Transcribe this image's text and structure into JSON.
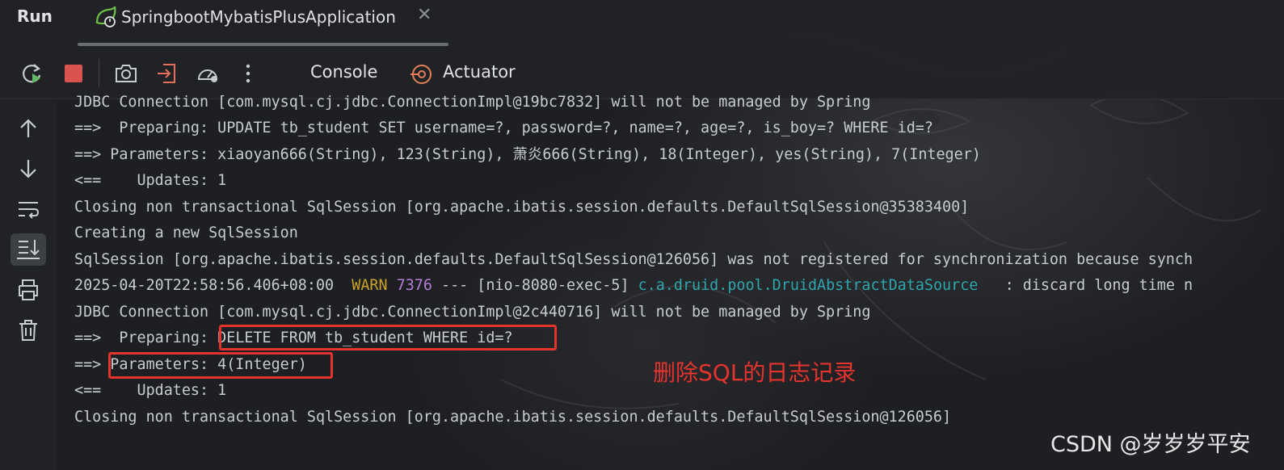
{
  "window": {
    "run_label": "Run",
    "tab_title": "SpringbootMybatisPlusApplication",
    "tab_close": "✕"
  },
  "toolbar": {
    "tabs": [
      "Console",
      "Actuator"
    ]
  },
  "console": {
    "lines": [
      {
        "text": "JDBC Connection [com.mysql.cj.jdbc.ConnectionImpl@19bc7832] will not be managed by Spring"
      },
      {
        "text": "==>  Preparing: UPDATE tb_student SET username=?, password=?, name=?, age=?, is_boy=? WHERE id=?"
      },
      {
        "text": "==> Parameters: xiaoyan666(String), 123(String), 萧炎666(String), 18(Integer), yes(String), 7(Integer)"
      },
      {
        "text": "<==    Updates: 1"
      },
      {
        "text": "Closing non transactional SqlSession [org.apache.ibatis.session.defaults.DefaultSqlSession@35383400]"
      },
      {
        "text": "Creating a new SqlSession"
      },
      {
        "text": "SqlSession [org.apache.ibatis.session.defaults.DefaultSqlSession@126056] was not registered for synchronization because synch"
      },
      {
        "timestamp": "2025-04-20T22:58:56.406+08:00",
        "level": "WARN",
        "pid": "7376",
        "thread": "--- [nio-8080-exec-5]",
        "logger": "c.a.druid.pool.DruidAbstractDataSource",
        "message": ": discard long time n"
      },
      {
        "text": "JDBC Connection [com.mysql.cj.jdbc.ConnectionImpl@2c440716] will not be managed by Spring"
      },
      {
        "prefix": "==>  Preparing:",
        "highlight": "DELETE FROM tb_student WHERE id=?"
      },
      {
        "prefix": "==>",
        "highlight": "Parameters: 4(Integer)"
      },
      {
        "text": "<==    Updates: 1"
      },
      {
        "text": "Closing non transactional SqlSession [org.apache.ibatis.session.defaults.DefaultSqlSession@126056]"
      }
    ]
  },
  "annotation": "删除SQL的日志记录",
  "watermark": "CSDN @岁岁岁平安",
  "colors": {
    "background": "#1e1f22",
    "text": "#c8cbd0",
    "warn": "#c9a227",
    "pid": "#b37fd6",
    "logger": "#2ea6ad",
    "highlight": "#e5332e",
    "stop": "#d9534f",
    "rerun": "#5fb865"
  },
  "icons": [
    "rerun-icon",
    "stop-icon",
    "screenshot-icon",
    "export-icon",
    "profiler-icon",
    "more-icon",
    "actuator-icon",
    "scroll-up-icon",
    "scroll-down-icon",
    "soft-wrap-icon",
    "scroll-to-end-icon",
    "print-icon",
    "clear-icon"
  ]
}
